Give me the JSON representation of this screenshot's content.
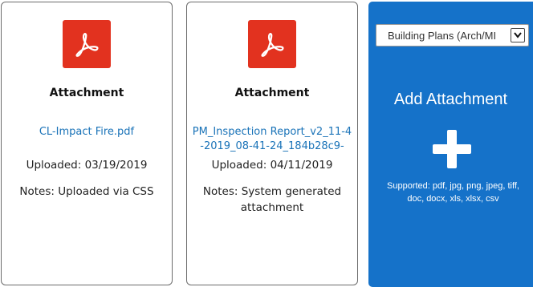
{
  "attachments": [
    {
      "icon": "pdf-icon",
      "title": "Attachment",
      "file_name": "CL-Impact Fire.pdf",
      "uploaded": "Uploaded: 03/19/2019",
      "notes": "Notes: Uploaded via CSS"
    },
    {
      "icon": "pdf-icon",
      "title": "Attachment",
      "file_name": "PM_Inspection Report_v2_11-4-2019_08-41-24_184b28c9-",
      "uploaded": "Uploaded: 04/11/2019",
      "notes": "Notes: System generated attachment"
    }
  ],
  "add_panel": {
    "category_selected": "Building Plans (Arch/MI",
    "title": "Add Attachment",
    "icon": "plus-icon",
    "supported": "Supported: pdf, jpg, png, jpeg, tiff, doc, docx, xls, xlsx, csv",
    "background_color": "#1572c9"
  },
  "colors": {
    "pdf_red": "#e2321f",
    "link_blue": "#1a73b8"
  }
}
